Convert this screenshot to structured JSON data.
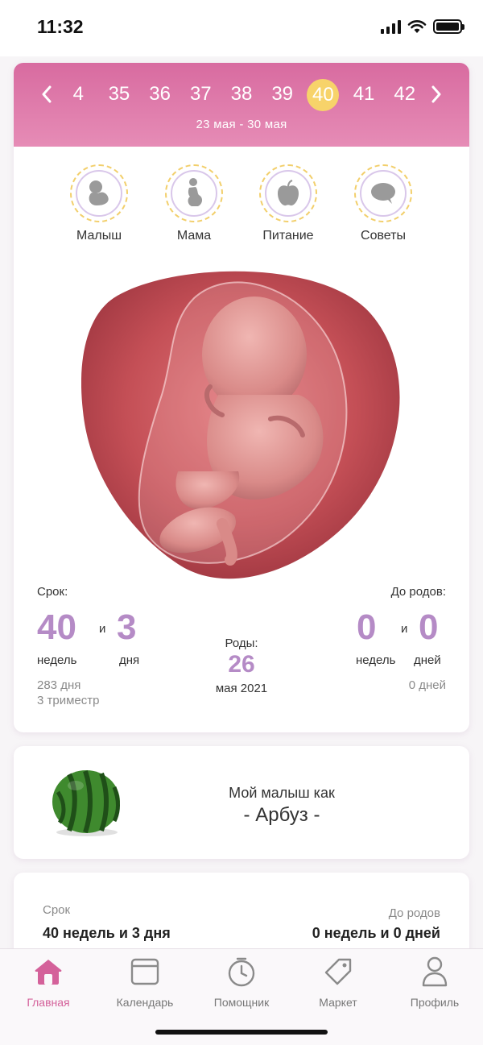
{
  "status_bar": {
    "time": "11:32"
  },
  "weeks": {
    "items": [
      "4",
      "35",
      "36",
      "37",
      "38",
      "39",
      "40",
      "41",
      "42"
    ],
    "active": "40",
    "dates": "23 мая - 30 мая"
  },
  "categories": [
    {
      "label": "Малыш",
      "icon": "baby-icon"
    },
    {
      "label": "Мама",
      "icon": "pregnant-mother-icon"
    },
    {
      "label": "Питание",
      "icon": "apple-icon"
    },
    {
      "label": "Советы",
      "icon": "chat-bubble-icon"
    }
  ],
  "term": {
    "label": "Срок:",
    "weeks_value": "40",
    "and": "и",
    "days_value": "3",
    "weeks_unit": "недель",
    "days_unit": "дня",
    "total_days": "283 дня",
    "trimester": "3 триместр"
  },
  "birth": {
    "label": "Роды:",
    "day": "26",
    "month_year": "мая 2021"
  },
  "until_birth": {
    "label": "До родов:",
    "weeks_value": "0",
    "and": "и",
    "days_value": "0",
    "weeks_unit": "недель",
    "days_unit": "дней",
    "total_days": "0 дней"
  },
  "fruit": {
    "title": "Мой малыш как",
    "name": "- Арбуз -",
    "icon": "watermelon-image"
  },
  "summary": {
    "term_label": "Срок",
    "term_value": "40 недель и 3 дня",
    "until_label": "До родов",
    "until_value": "0 недель и 0 дней"
  },
  "tabs": [
    {
      "label": "Главная",
      "icon": "home-icon",
      "active": true
    },
    {
      "label": "Календарь",
      "icon": "calendar-icon"
    },
    {
      "label": "Помощник",
      "icon": "clock-icon"
    },
    {
      "label": "Маркет",
      "icon": "tag-icon"
    },
    {
      "label": "Профиль",
      "icon": "person-icon"
    }
  ],
  "colors": {
    "accent_pink": "#d86ba0",
    "number_purple": "#b58bc6",
    "active_week": "#f7d36a"
  }
}
